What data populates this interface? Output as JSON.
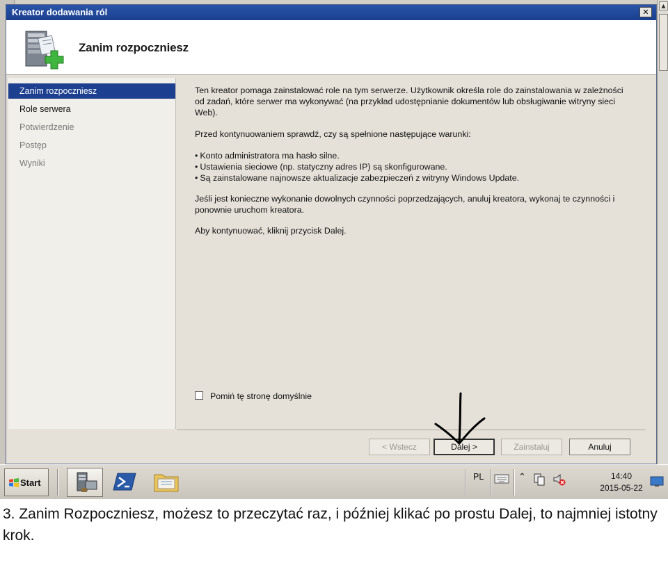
{
  "window": {
    "title": "Kreator dodawania ról",
    "close_label": "✕",
    "header_title": "Zanim rozpoczniesz"
  },
  "sidebar": {
    "items": [
      {
        "label": "Zanim rozpoczniesz",
        "state": "active"
      },
      {
        "label": "Role serwera",
        "state": "normal"
      },
      {
        "label": "Potwierdzenie",
        "state": "disabled"
      },
      {
        "label": "Postęp",
        "state": "disabled"
      },
      {
        "label": "Wyniki",
        "state": "disabled"
      }
    ]
  },
  "content": {
    "paragraph1": "Ten kreator pomaga zainstalować role na tym serwerze. Użytkownik określa role do zainstalowania w zależności od zadań, które serwer ma wykonywać (na przykład udostępnianie dokumentów lub obsługiwanie witryny sieci Web).",
    "paragraph2": "Przed kontynuowaniem sprawdź, czy są spełnione następujące warunki:",
    "bullets": [
      "Konto administratora ma hasło silne.",
      "Ustawienia sieciowe (np. statyczny adres IP) są skonfigurowane.",
      "Są zainstalowane najnowsze aktualizacje zabezpieczeń z witryny Windows Update."
    ],
    "paragraph3": "Jeśli jest konieczne wykonanie dowolnych czynności poprzedzających, anuluj kreatora, wykonaj te czynności i ponownie uruchom kreatora.",
    "paragraph4": "Aby kontynuować, kliknij przycisk Dalej.",
    "skip_checkbox_label": "Pomiń tę stronę domyślnie"
  },
  "buttons": {
    "back": "< Wstecz",
    "next": "Dalej >",
    "install": "Zainstaluj",
    "cancel": "Anuluj"
  },
  "taskbar": {
    "start_label": "Start",
    "language": "PL",
    "clock_time": "14:40",
    "clock_date": "2015-05-22",
    "tray_arrow": "⌃"
  },
  "caption": "3. Zanim Rozpoczniesz, możesz to przeczytać raz, i później klikać po prostu Dalej, to najmniej istotny krok.",
  "colors": {
    "titlebar": "#1a3f8e",
    "selected_item": "#1d3f8f",
    "window_bg": "#e5e1d9"
  }
}
